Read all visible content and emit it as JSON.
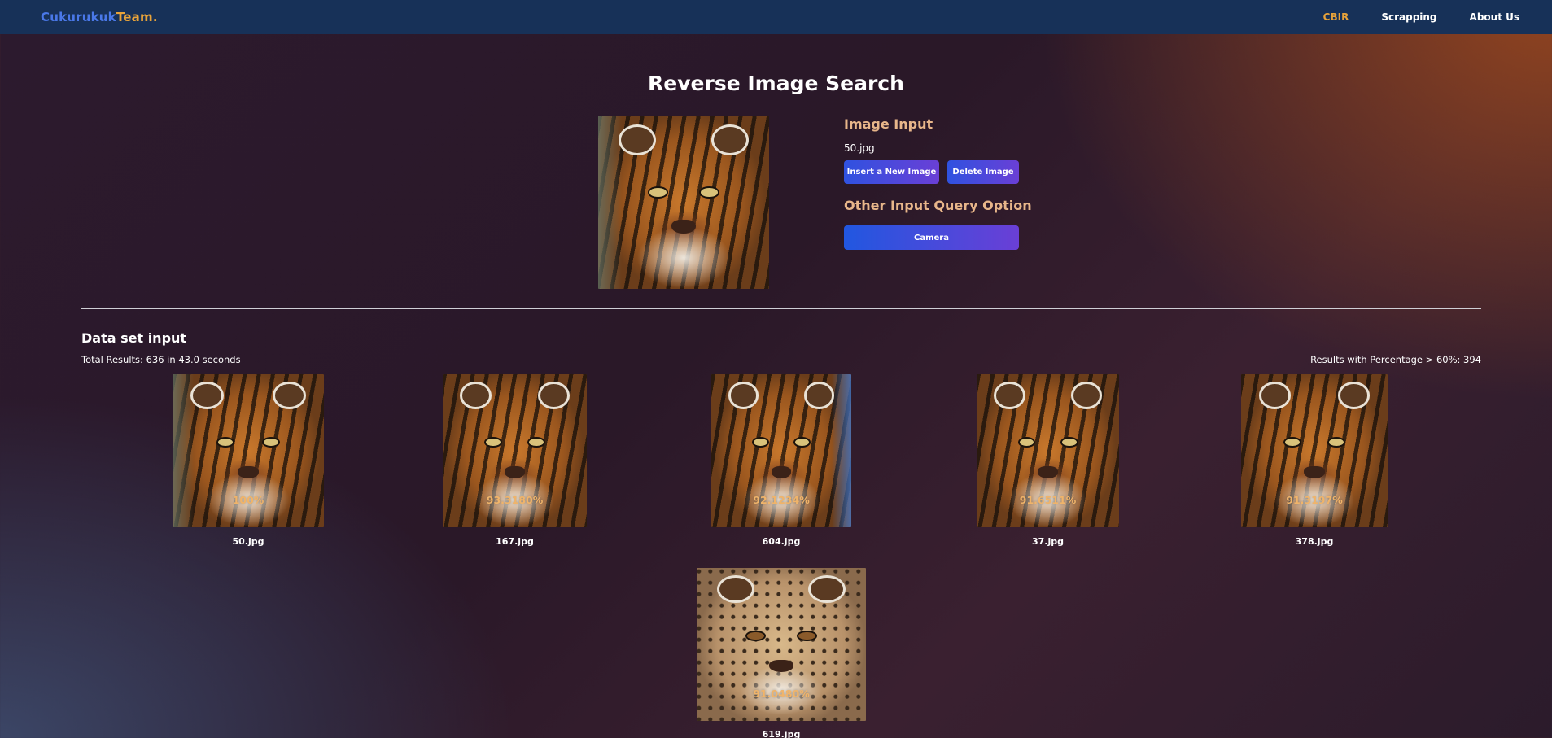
{
  "navbar": {
    "brand_part1": "Cukurukuk",
    "brand_part2": "Team.",
    "links": [
      {
        "label": "CBIR",
        "active": true
      },
      {
        "label": "Scrapping",
        "active": false
      },
      {
        "label": "About Us",
        "active": false
      }
    ]
  },
  "page_title": "Reverse Image Search",
  "query": {
    "heading": "Image Input",
    "file_name": "50.jpg",
    "insert_button": "Insert a New Image",
    "delete_button": "Delete Image",
    "other_heading": "Other Input Query Option",
    "camera_button": "Camera"
  },
  "dataset": {
    "title": "Data set input",
    "total_results": "Total Results: 636 in 43.0 seconds",
    "percent_results": "Results with Percentage > 60%: 394",
    "results": [
      {
        "file": "50.jpg",
        "percentage": "100%"
      },
      {
        "file": "167.jpg",
        "percentage": "93.3180%"
      },
      {
        "file": "604.jpg",
        "percentage": "92.1234%"
      },
      {
        "file": "37.jpg",
        "percentage": "91.6511%"
      },
      {
        "file": "378.jpg",
        "percentage": "91.3197%"
      },
      {
        "file": "619.jpg",
        "percentage": "91.0480%"
      }
    ]
  },
  "colors": {
    "navbar_bg": "#173158",
    "brand_blue": "#4a78e8",
    "accent_orange": "#e8a33a",
    "heading_peach": "#e8b68a",
    "button_gradient_start": "#2f52e0",
    "button_gradient_end": "#6a3fd6",
    "percentage_text": "#f0b46a"
  }
}
